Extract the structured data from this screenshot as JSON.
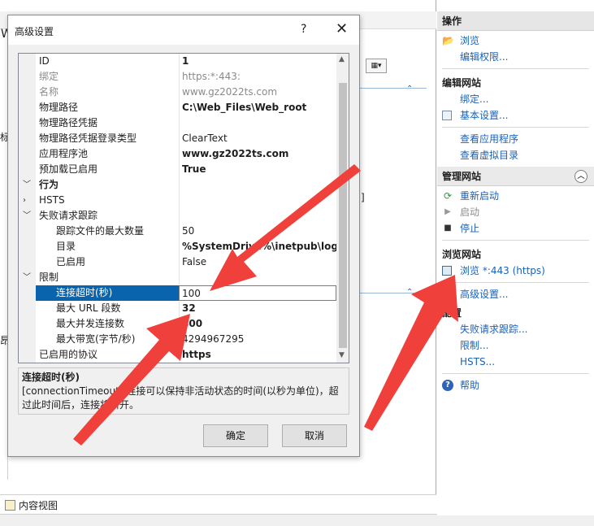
{
  "background": {
    "fragments": [
      "W",
      "标",
      "昂",
      "]"
    ],
    "bottom_tab": "内容视图"
  },
  "actions": {
    "header": "操作",
    "browse": "浏览",
    "edit_permissions": "编辑权限...",
    "edit_site_title": "编辑网站",
    "bindings": "绑定...",
    "basic_settings": "基本设置...",
    "view_apps": "查看应用程序",
    "view_vdirs": "查看虚拟目录",
    "manage_site_title": "管理网站",
    "restart": "重新启动",
    "start": "启动",
    "stop": "停止",
    "browse_site_title": "浏览网站",
    "browse_https": "浏览 *:443 (https)",
    "advanced_settings": "高级设置...",
    "config_title": "配置",
    "failed_request": "失败请求跟踪...",
    "limits": "限制...",
    "hsts": "HSTS...",
    "help": "帮助"
  },
  "dialog": {
    "title": "高级设置",
    "help": "?",
    "close": "✕",
    "rows": [
      {
        "name": "ID",
        "value": "1"
      },
      {
        "name": "绑定",
        "value": "https:*:443:"
      },
      {
        "name": "名称",
        "value": "www.gz2022ts.com"
      },
      {
        "name": "物理路径",
        "value": "C:\\Web_Files\\Web_root"
      },
      {
        "name": "物理路径凭据",
        "value": ""
      },
      {
        "name": "物理路径凭据登录类型",
        "value": "ClearText"
      },
      {
        "name": "应用程序池",
        "value": "www.gz2022ts.com"
      },
      {
        "name": "预加载已启用",
        "value": "True"
      },
      {
        "name": "行为",
        "value": ""
      },
      {
        "name": "HSTS",
        "value": ""
      },
      {
        "name": "失败请求跟踪",
        "value": ""
      },
      {
        "name": "跟踪文件的最大数量",
        "value": "50"
      },
      {
        "name": "目录",
        "value": "%SystemDrive%\\inetpub\\logs\\"
      },
      {
        "name": "已启用",
        "value": "False"
      },
      {
        "name": "限制",
        "value": ""
      },
      {
        "name": "连接超时(秒)",
        "value": "100"
      },
      {
        "name": "最大 URL 段数",
        "value": "32"
      },
      {
        "name": "最大并发连接数",
        "value": "600"
      },
      {
        "name": "最大带宽(字节/秒)",
        "value": "4294967295"
      },
      {
        "name": "已启用的协议",
        "value": "https"
      }
    ],
    "desc_title": "连接超时(秒)",
    "desc_text": "[connectionTimeout] 连接可以保持非活动状态的时间(以秒为单位)，超过此时间后，连接将断开。",
    "ok": "确定",
    "cancel": "取消"
  },
  "colors": {
    "selection": "#0a64ad",
    "link": "#1a62b8",
    "arrow": "#f0403c"
  }
}
